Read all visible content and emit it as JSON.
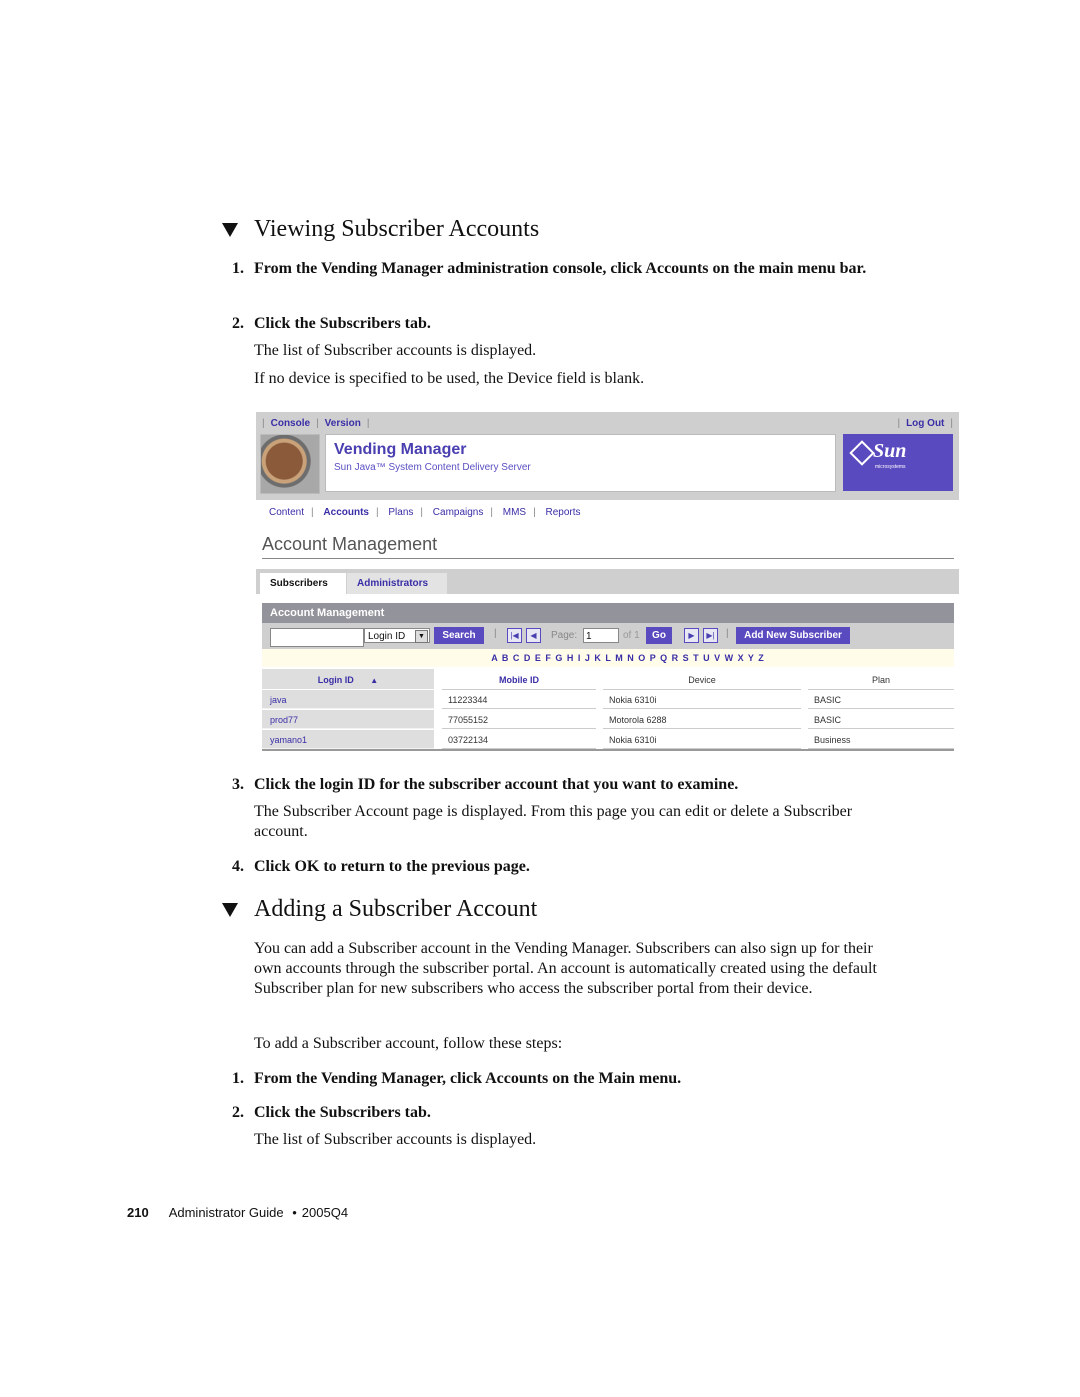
{
  "section1": {
    "heading": "Viewing Subscriber Accounts",
    "steps": [
      {
        "num": "1.",
        "text": "From the Vending Manager administration console, click Accounts on the main menu bar."
      },
      {
        "num": "2.",
        "text": "Click the Subscribers tab."
      }
    ],
    "paras": [
      "The list of Subscriber accounts is displayed.",
      "If no device is specified to be used, the Device field is blank."
    ],
    "steps_after": [
      {
        "num": "3.",
        "text": "Click the login ID for the subscriber account that you want to examine."
      },
      {
        "num": "4.",
        "text": "Click OK to return to the previous page."
      }
    ],
    "para_after_step3": "The Subscriber Account page is displayed. From this page you can edit or delete a Subscriber account."
  },
  "ui": {
    "utility_links": {
      "console": "Console",
      "version": "Version",
      "logout": "Log Out"
    },
    "app_title": "Vending Manager",
    "app_subtitle": "Sun Java™ System Content Delivery Server",
    "sun_logo": "Sun",
    "sun_logo_sub": "microsystems",
    "nav": [
      {
        "label": "Content",
        "active": false
      },
      {
        "label": "Accounts",
        "active": true
      },
      {
        "label": "Plans",
        "active": false
      },
      {
        "label": "Campaigns",
        "active": false
      },
      {
        "label": "MMS",
        "active": false
      },
      {
        "label": "Reports",
        "active": false
      }
    ],
    "page_title": "Account Management",
    "tabs": [
      {
        "label": "Subscribers",
        "selected": true
      },
      {
        "label": "Administrators",
        "selected": false
      }
    ],
    "panel_title": "Account Management",
    "toolbar": {
      "search_value": "",
      "search_field_selected": "Login ID",
      "search_button": "Search",
      "page_label": "Page:",
      "page_value": "1",
      "page_of": "of 1",
      "go_button": "Go",
      "add_button": "Add New Subscriber"
    },
    "alphabet": "A B C D E F G H I J K L M N O P Q R S T U V W X Y Z",
    "table": {
      "columns": [
        "Login ID",
        "Mobile ID",
        "Device",
        "Plan"
      ],
      "sort_column": "Login ID",
      "sort_direction": "ascending",
      "rows": [
        {
          "login": "java",
          "mobile": "11223344",
          "device": "Nokia 6310i",
          "plan": "BASIC"
        },
        {
          "login": "prod77",
          "mobile": "77055152",
          "device": "Motorola 6288",
          "plan": "BASIC"
        },
        {
          "login": "yamano1",
          "mobile": "03722134",
          "device": "Nokia 6310i",
          "plan": "Business"
        }
      ]
    },
    "colors": {
      "accent": "#5a4abf",
      "link": "#3a2ea6",
      "panel_header": "#93939b",
      "alpha_bar": "#fffdea"
    }
  },
  "section2": {
    "heading": "Adding a Subscriber Account",
    "intro": "You can add a Subscriber account in the Vending Manager. Subscribers can also sign up for their own accounts through the subscriber portal. An account is automatically created using the default Subscriber plan for new subscribers who access the subscriber portal from their device.",
    "lead": "To add a Subscriber account, follow these steps:",
    "steps": [
      {
        "num": "1.",
        "text": "From the Vending Manager, click Accounts on the Main menu."
      },
      {
        "num": "2.",
        "text": "Click the Subscribers tab."
      }
    ],
    "para": "The list of Subscriber accounts is displayed."
  },
  "footer": {
    "page_number": "210",
    "title": "Administrator Guide",
    "bullet": "•",
    "edition": "2005Q4"
  }
}
